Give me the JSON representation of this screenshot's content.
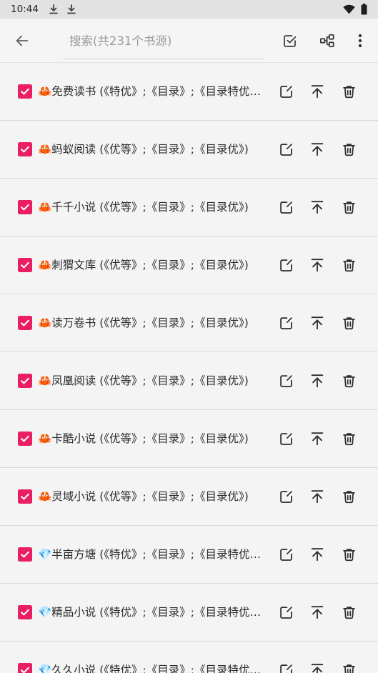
{
  "colors": {
    "accent": "#e91e63",
    "background": "#f4f4f4",
    "status_bar": "#e2e2e2",
    "divider": "#d9d9d9"
  },
  "status_bar": {
    "time": "10:44",
    "notification_icons": [
      "download-icon",
      "download-icon"
    ],
    "system_icons": [
      "wifi-icon",
      "battery-icon"
    ]
  },
  "toolbar": {
    "back_icon": "arrow-back-icon",
    "search": {
      "value": "",
      "placeholder": "搜索(共231个书源)"
    },
    "actions": [
      "check-square-icon",
      "group-icon",
      "more-vert-icon"
    ]
  },
  "row_actions": [
    "edit-icon",
    "move-to-top-icon",
    "delete-icon"
  ],
  "sources": [
    {
      "label": "🦀免费读书 (《特优》;《目录》;《目录特优…",
      "checked": true
    },
    {
      "label": "🦀蚂蚁阅读 (《优等》;《目录》;《目录优》)",
      "checked": true
    },
    {
      "label": "🦀千千小说 (《优等》;《目录》;《目录优》)",
      "checked": true
    },
    {
      "label": "🦀刺猬文库 (《优等》;《目录》;《目录优》)",
      "checked": true
    },
    {
      "label": "🦀读万卷书 (《优等》;《目录》;《目录优》)",
      "checked": true
    },
    {
      "label": "🦀凤凰阅读 (《优等》;《目录》;《目录优》)",
      "checked": true
    },
    {
      "label": "🦀卡酷小说 (《优等》;《目录》;《目录优》)",
      "checked": true
    },
    {
      "label": "🦀灵域小说 (《优等》;《目录》;《目录优》)",
      "checked": true
    },
    {
      "label": "💎半亩方塘 (《特优》;《目录》;《目录特优…",
      "checked": true
    },
    {
      "label": "💎精品小说 (《特优》;《目录》;《目录特优…",
      "checked": true
    },
    {
      "label": "💎久久小说 (《特优》;《目录》;《目录特优…",
      "checked": true
    }
  ]
}
